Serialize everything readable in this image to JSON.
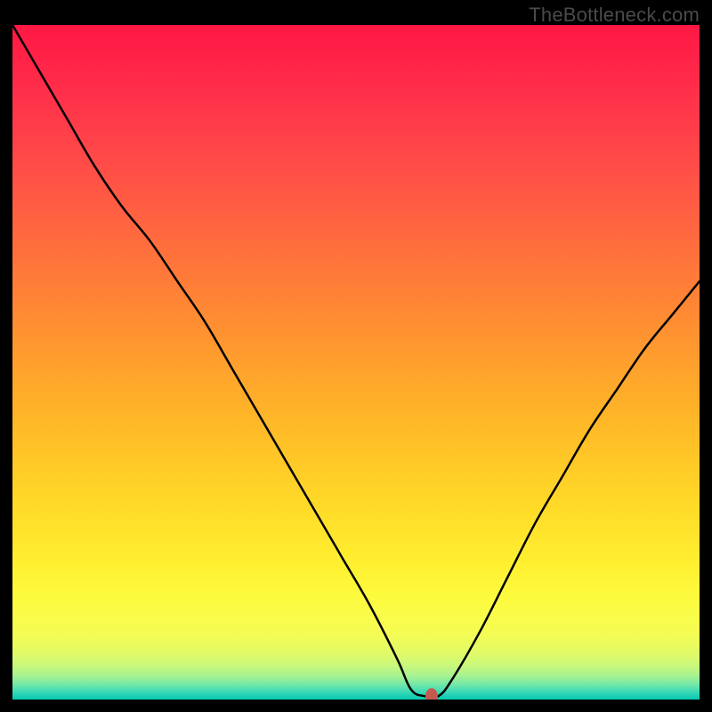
{
  "watermark": "TheBottleneck.com",
  "chart_data": {
    "type": "line",
    "title": "",
    "xlabel": "",
    "ylabel": "",
    "xlim": [
      0,
      100
    ],
    "ylim": [
      0,
      100
    ],
    "x": [
      0,
      4,
      8,
      12,
      16,
      20,
      24,
      28,
      32,
      36,
      40,
      44,
      48,
      52,
      56,
      58,
      60,
      62,
      64,
      68,
      72,
      76,
      80,
      84,
      88,
      92,
      96,
      100
    ],
    "values": [
      100,
      93,
      86,
      79,
      73,
      68,
      62,
      56,
      49,
      42,
      35,
      28,
      21,
      14,
      6,
      1.5,
      0.5,
      0.5,
      3,
      10,
      18,
      26,
      33,
      40,
      46,
      52,
      57,
      62
    ],
    "marker": {
      "x": 61,
      "y": 0.5,
      "color": "#c45a4f"
    },
    "gradient_stops_pct": [
      0,
      10,
      20,
      30,
      40,
      50,
      60,
      70,
      80,
      85,
      90,
      93,
      95,
      96.5,
      97.5,
      98.3,
      99,
      99.5,
      100
    ],
    "gradient_colors": [
      "#ff1744",
      "#ff2f4a",
      "#ff4a48",
      "#ff6640",
      "#ff8236",
      "#ff9f2d",
      "#ffbb27",
      "#ffd727",
      "#fff030",
      "#fdfb3f",
      "#f5fc52",
      "#e3fa66",
      "#c8f77c",
      "#a6f291",
      "#7feaa3",
      "#58e1b0",
      "#35d7b6",
      "#1bcfb4",
      "#06c9af"
    ]
  }
}
